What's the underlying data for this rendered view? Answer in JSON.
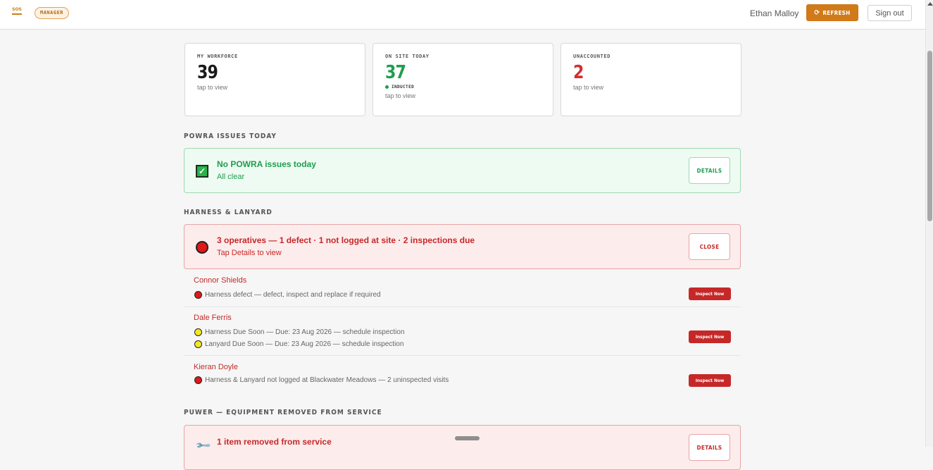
{
  "header": {
    "logo_text": "SOS",
    "role_badge": "MANAGER",
    "user_name": "Ethan Malloy",
    "refresh_label": "REFRESH",
    "signout_label": "Sign out"
  },
  "stats": [
    {
      "label": "MY WORKFORCE",
      "value": "39",
      "sub": "tap to view",
      "color": "#1a1a1a"
    },
    {
      "label": "ON SITE TODAY",
      "value": "37",
      "status": "INDUCTED",
      "sub": "tap to view",
      "color": "#1f9d4f"
    },
    {
      "label": "UNACCOUNTED",
      "value": "2",
      "sub": "tap to view",
      "color": "#d32f2f"
    }
  ],
  "powra": {
    "section_title": "POWRA ISSUES TODAY",
    "title": "No POWRA issues today",
    "subtitle": "All clear",
    "button": "DETAILS"
  },
  "harness": {
    "section_title": "HARNESS & LANYARD",
    "title": "3 operatives — 1 defect · 1 not logged at site · 2 inspections due",
    "subtitle": "Tap Details to view",
    "button": "CLOSE",
    "operatives": [
      {
        "name": "Connor Shields",
        "issues": [
          {
            "status": "red",
            "text": "Harness defect — defect, inspect and replace if required"
          }
        ],
        "action": "Inspect Now"
      },
      {
        "name": "Dale Ferris",
        "issues": [
          {
            "status": "yellow",
            "text": "Harness Due Soon — Due: 23 Aug 2026 — schedule inspection"
          },
          {
            "status": "yellow",
            "text": "Lanyard Due Soon — Due: 23 Aug 2026 — schedule inspection"
          }
        ],
        "action": "Inspect Now"
      },
      {
        "name": "Kieran Doyle",
        "issues": [
          {
            "status": "red",
            "text": "Harness & Lanyard not logged at Blackwater Meadows — 2 uninspected visits"
          }
        ],
        "action": "Inspect Now"
      }
    ]
  },
  "puwer": {
    "section_title": "PUWER — EQUIPMENT REMOVED FROM SERVICE",
    "title": "1 item removed from service",
    "button": "DETAILS"
  },
  "colors": {
    "accent": "#d07a1a",
    "green": "#1f9d4f",
    "red": "#c62828"
  }
}
